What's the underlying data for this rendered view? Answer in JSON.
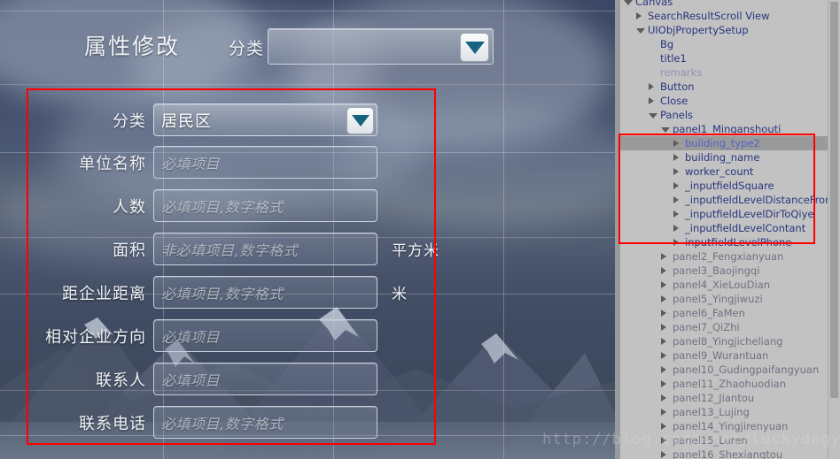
{
  "game_view": {
    "title": "属性修改",
    "top_category_label": "分类",
    "top_dropdown_value": "",
    "dropdown_icon": "chevron-down-icon",
    "watermark": "http://blog.csdn.net/luckydogyxx",
    "form": {
      "rows": [
        {
          "label": "分类",
          "type": "select",
          "value": "居民区",
          "placeholder": "",
          "unit": ""
        },
        {
          "label": "单位名称",
          "type": "input",
          "value": "",
          "placeholder": "必填项目",
          "unit": ""
        },
        {
          "label": "人数",
          "type": "input",
          "value": "",
          "placeholder": "必填项目,数字格式",
          "unit": ""
        },
        {
          "label": "面积",
          "type": "input",
          "value": "",
          "placeholder": "非必填项目,数字格式",
          "unit": "平方米"
        },
        {
          "label": "距企业距离",
          "type": "input",
          "value": "",
          "placeholder": "必填项目,数字格式",
          "unit": "米"
        },
        {
          "label": "相对企业方向",
          "type": "input",
          "value": "",
          "placeholder": "必填项目",
          "unit": ""
        },
        {
          "label": "联系人",
          "type": "input",
          "value": "",
          "placeholder": "必填项目",
          "unit": ""
        },
        {
          "label": "联系电话",
          "type": "input",
          "value": "",
          "placeholder": "必填项目,数字格式",
          "unit": ""
        }
      ]
    }
  },
  "annotations": {
    "form_highlight_color": "#ff0000",
    "tree_highlight_color": "#ff0000"
  },
  "hierarchy": {
    "nodes": [
      {
        "label": "Canvas",
        "indent": 0,
        "toggle": "open",
        "state": "normal"
      },
      {
        "label": "SearchResultScroll View",
        "indent": 1,
        "toggle": "closed",
        "state": "normal"
      },
      {
        "label": "UIObjPropertySetup",
        "indent": 1,
        "toggle": "open",
        "state": "normal"
      },
      {
        "label": "Bg",
        "indent": 2,
        "toggle": "none",
        "state": "normal"
      },
      {
        "label": "title1",
        "indent": 2,
        "toggle": "none",
        "state": "normal"
      },
      {
        "label": "remarks",
        "indent": 2,
        "toggle": "none",
        "state": "dim"
      },
      {
        "label": "Button",
        "indent": 2,
        "toggle": "closed",
        "state": "normal"
      },
      {
        "label": "Close",
        "indent": 2,
        "toggle": "closed",
        "state": "normal"
      },
      {
        "label": "Panels",
        "indent": 2,
        "toggle": "open",
        "state": "normal"
      },
      {
        "label": "panel1_Minganshouti",
        "indent": 3,
        "toggle": "open",
        "state": "normal"
      },
      {
        "label": "building_type2",
        "indent": 4,
        "toggle": "closed",
        "state": "selected"
      },
      {
        "label": "building_name",
        "indent": 4,
        "toggle": "closed",
        "state": "normal"
      },
      {
        "label": "worker_count",
        "indent": 4,
        "toggle": "closed",
        "state": "normal"
      },
      {
        "label": "_inputfieldSquare",
        "indent": 4,
        "toggle": "closed",
        "state": "normal"
      },
      {
        "label": "_inputfieldLevelDistanceFromQiye",
        "indent": 4,
        "toggle": "closed",
        "state": "normal"
      },
      {
        "label": "_inputfieldLevelDirToQiye",
        "indent": 4,
        "toggle": "closed",
        "state": "normal"
      },
      {
        "label": "_inputfieldLevelContant",
        "indent": 4,
        "toggle": "closed",
        "state": "normal"
      },
      {
        "label": "inputfieldLevelPhone",
        "indent": 4,
        "toggle": "closed",
        "state": "normal"
      },
      {
        "label": "panel2_Fengxianyuan",
        "indent": 3,
        "toggle": "closed",
        "state": "gray"
      },
      {
        "label": "panel3_Baojingqi",
        "indent": 3,
        "toggle": "closed",
        "state": "gray"
      },
      {
        "label": "panel4_XieLouDian",
        "indent": 3,
        "toggle": "closed",
        "state": "gray"
      },
      {
        "label": "panel5_Yingjiwuzi",
        "indent": 3,
        "toggle": "closed",
        "state": "gray"
      },
      {
        "label": "panel6_FaMen",
        "indent": 3,
        "toggle": "closed",
        "state": "gray"
      },
      {
        "label": "panel7_QiZhi",
        "indent": 3,
        "toggle": "closed",
        "state": "gray"
      },
      {
        "label": "panel8_Yingjicheliang",
        "indent": 3,
        "toggle": "closed",
        "state": "gray"
      },
      {
        "label": "panel9_Wurantuan",
        "indent": 3,
        "toggle": "closed",
        "state": "gray"
      },
      {
        "label": "panel10_Gudingpaifangyuan",
        "indent": 3,
        "toggle": "closed",
        "state": "gray"
      },
      {
        "label": "panel11_Zhaohuodian",
        "indent": 3,
        "toggle": "closed",
        "state": "gray"
      },
      {
        "label": "panel12_Jiantou",
        "indent": 3,
        "toggle": "closed",
        "state": "gray"
      },
      {
        "label": "panel13_Lujing",
        "indent": 3,
        "toggle": "closed",
        "state": "gray"
      },
      {
        "label": "panel14_Yingjirenyuan",
        "indent": 3,
        "toggle": "closed",
        "state": "gray"
      },
      {
        "label": "panel15_Luren",
        "indent": 3,
        "toggle": "closed",
        "state": "gray"
      },
      {
        "label": "panel16_Shexiangtou",
        "indent": 3,
        "toggle": "closed",
        "state": "gray"
      }
    ]
  }
}
